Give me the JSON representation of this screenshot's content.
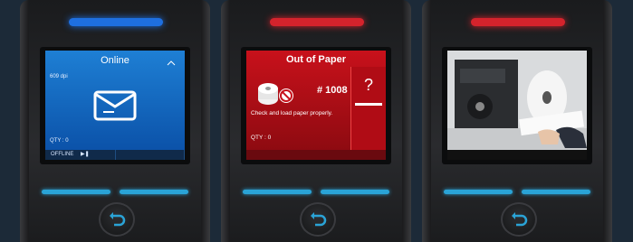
{
  "panels": [
    {
      "led_color": "#1e6fe0",
      "screen": {
        "title": "Online",
        "dpi": "609 dpi",
        "qty": "QTY : 0",
        "icon": "paper-tray-icon",
        "status_icon": "wifi-icon"
      },
      "bottom_bar": {
        "offline_label": "OFFLINE",
        "play_pause_icon": "play-pause-icon"
      }
    },
    {
      "led_color": "#d4232c",
      "screen": {
        "title": "Out of Paper",
        "job_number": "# 1008",
        "message": "Check and load paper properly.",
        "qty": "QTY : 0",
        "help_label": "?",
        "icon": "no-paper-roll-icon"
      }
    },
    {
      "led_color": "#d4232c",
      "screen": {
        "content": "photo of printer paper loading",
        "icon": "printer-mechanism-photo"
      }
    }
  ],
  "colors": {
    "softkey": "#2aa3d6",
    "back_button_icon": "#2aa3d6"
  },
  "buttons": {
    "back_icon": "back-arrow-icon"
  }
}
